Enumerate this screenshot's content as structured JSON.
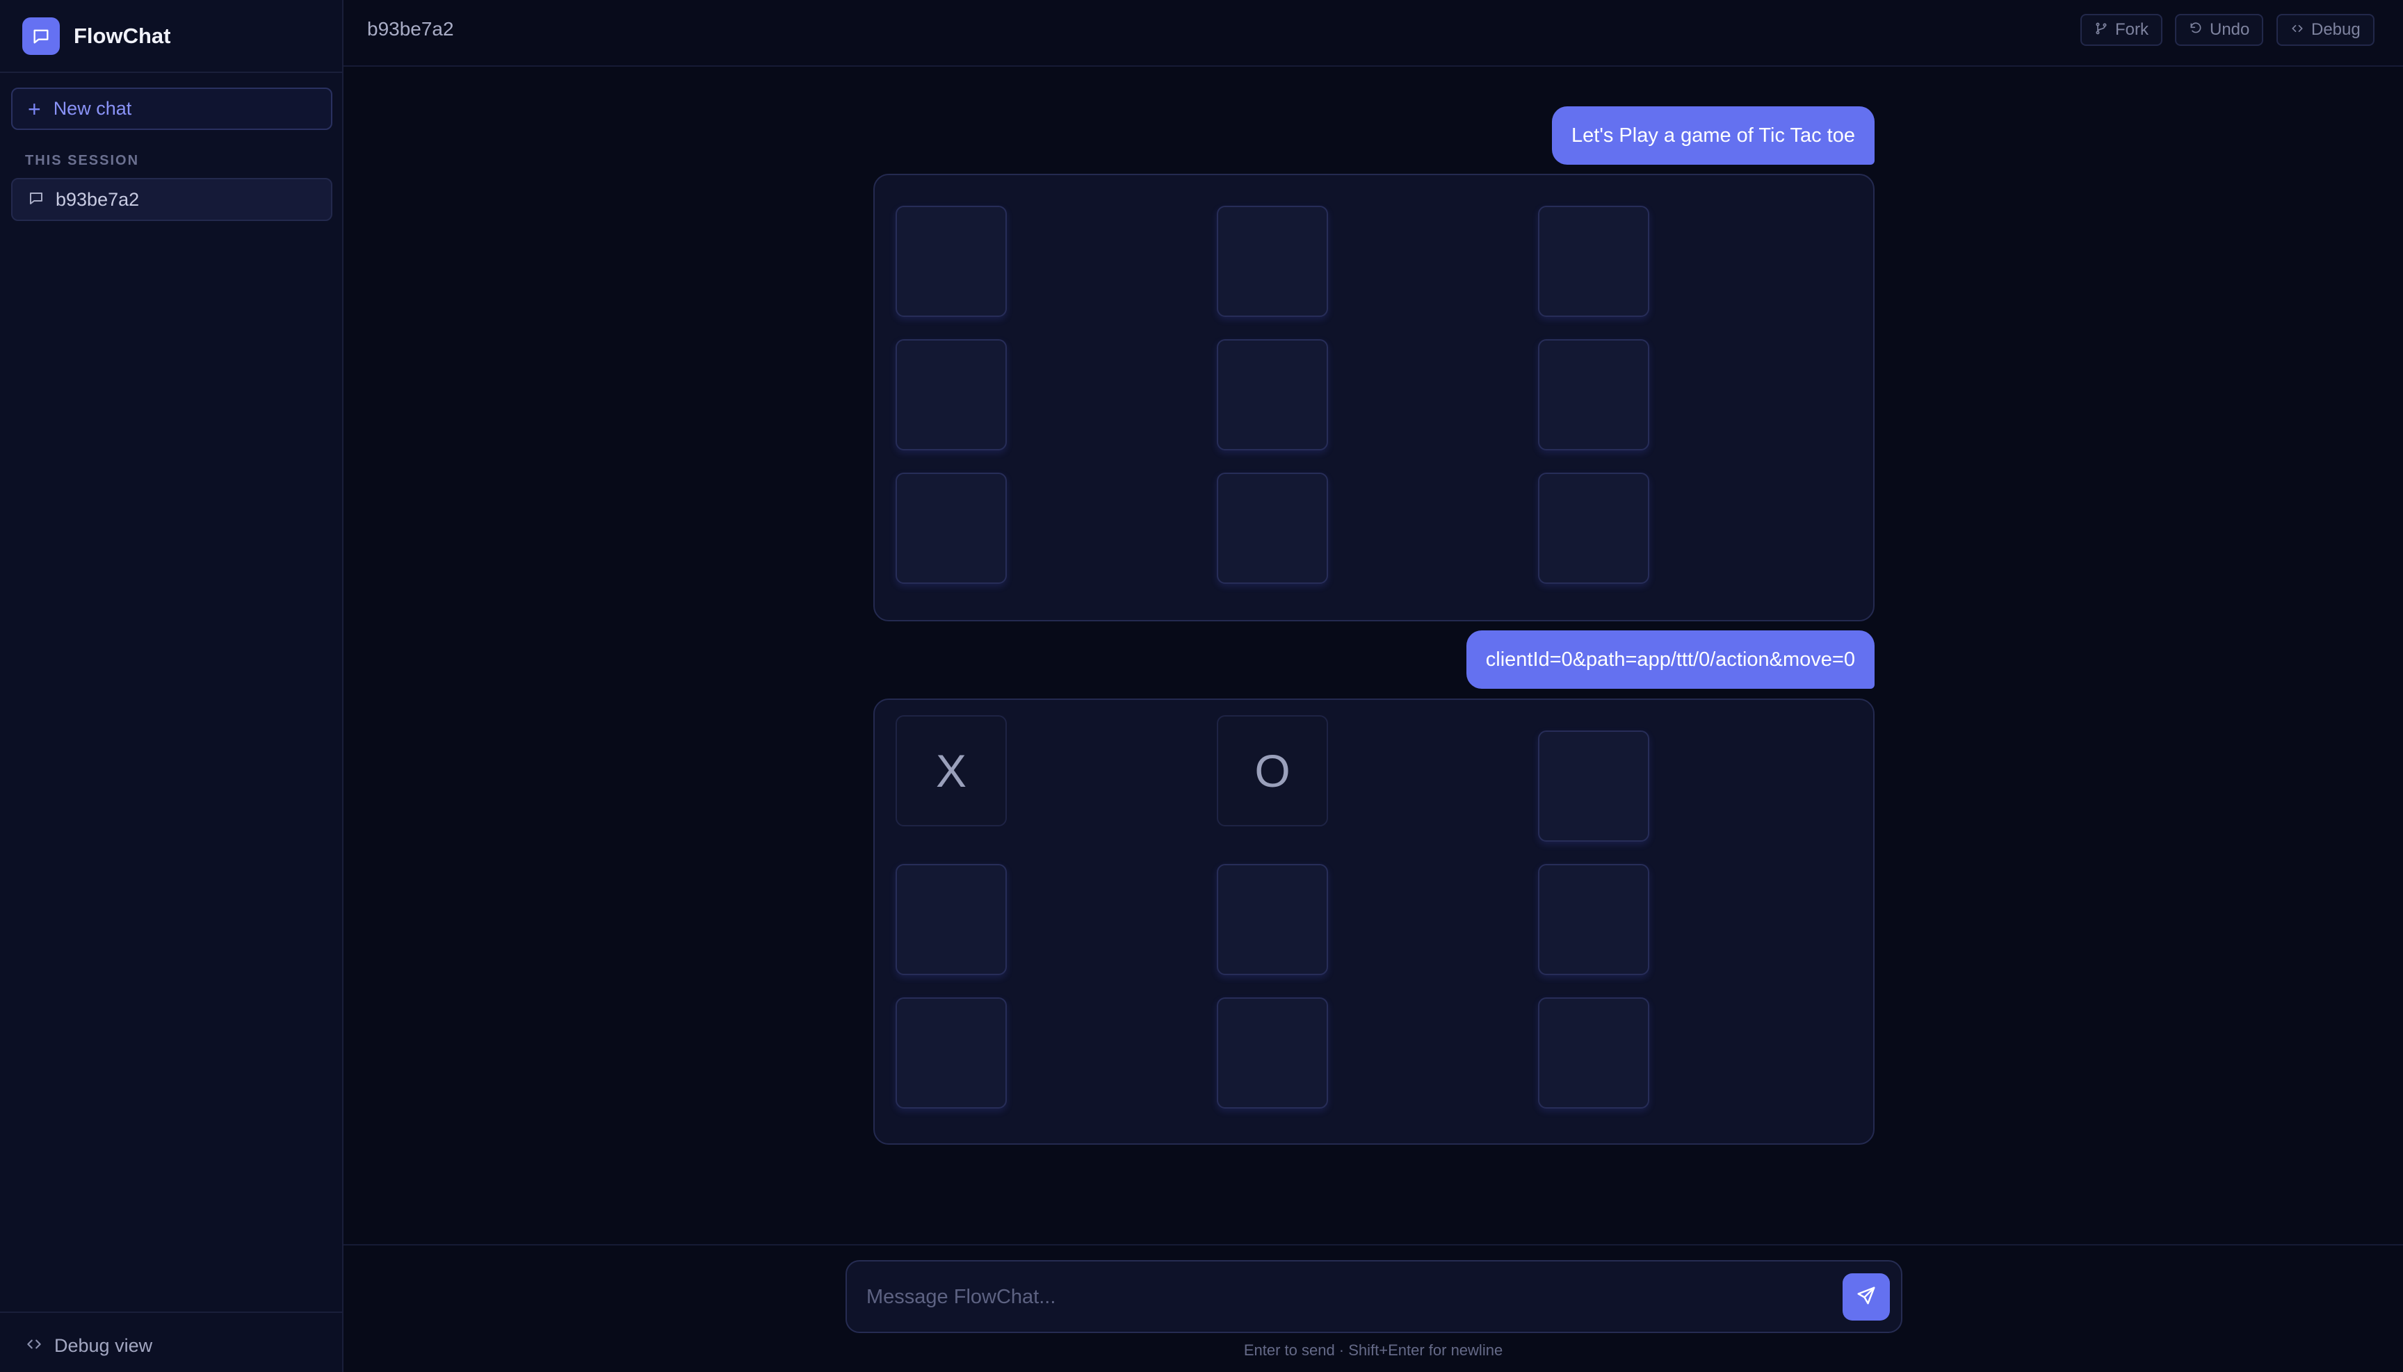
{
  "app": {
    "name": "FlowChat"
  },
  "sidebar": {
    "new_chat_label": "New chat",
    "section_label": "THIS SESSION",
    "sessions": [
      {
        "label": "b93be7a2"
      }
    ],
    "debug_view_label": "Debug view"
  },
  "header": {
    "title": "b93be7a2",
    "buttons": {
      "fork": "Fork",
      "undo": "Undo",
      "debug": "Debug"
    }
  },
  "messages": [
    {
      "role": "user",
      "text": "Let's Play a game of Tic Tac toe"
    },
    {
      "role": "app",
      "board": [
        "",
        "",
        "",
        "",
        "",
        "",
        "",
        "",
        ""
      ]
    },
    {
      "role": "user",
      "text": "clientId=0&path=app/ttt/0/action&move=0"
    },
    {
      "role": "app",
      "board": [
        "X",
        "O",
        "",
        "",
        "",
        "",
        "",
        "",
        ""
      ]
    }
  ],
  "composer": {
    "placeholder": "Message FlowChat...",
    "hint": "Enter to send · Shift+Enter for newline"
  },
  "colors": {
    "accent": "#6471f0",
    "background": "#070a18",
    "sidebar": "#0b0f24"
  }
}
